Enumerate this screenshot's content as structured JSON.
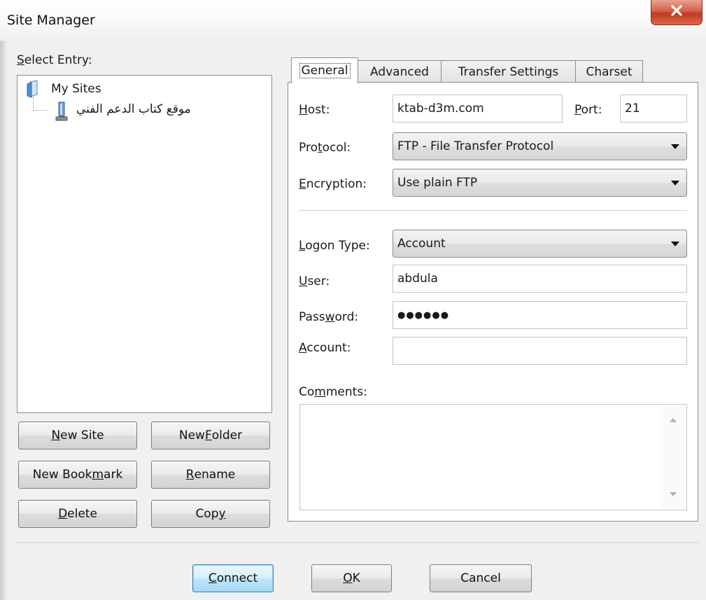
{
  "window": {
    "title": "Site Manager"
  },
  "select_entry": {
    "label_u": "S",
    "label_rest": "elect Entry:"
  },
  "tree": {
    "root": {
      "label": "My Sites",
      "icon": "folder-icon"
    },
    "site": {
      "label": "موقع كتاب الدعم الفني",
      "icon": "server-icon"
    }
  },
  "left_buttons": {
    "new_site": {
      "u": "N",
      "rest": "ew Site"
    },
    "new_folder": {
      "pre": "New ",
      "u": "F",
      "rest": "older"
    },
    "new_bookmark": {
      "pre": "New Book",
      "u": "m",
      "rest": "ark"
    },
    "rename": {
      "u": "R",
      "rest": "ename"
    },
    "delete": {
      "u": "D",
      "rest": "elete"
    },
    "copy": {
      "pre": "Cop",
      "u": "y"
    }
  },
  "tabs": [
    "General",
    "Advanced",
    "Transfer Settings",
    "Charset"
  ],
  "general": {
    "host": {
      "u": "H",
      "rest": "ost:",
      "value": "ktab-d3m.com"
    },
    "port": {
      "u": "P",
      "rest": "ort:",
      "value": "21"
    },
    "protocol": {
      "pre": "Pro",
      "u": "t",
      "rest": "ocol:",
      "value": "FTP - File Transfer Protocol"
    },
    "encryption": {
      "u": "E",
      "rest": "ncryption:",
      "value": "Use plain FTP"
    },
    "logon_type": {
      "u": "L",
      "rest": "ogon Type:",
      "value": "Account"
    },
    "user": {
      "u": "U",
      "rest": "ser:",
      "value": "abdula"
    },
    "password": {
      "pre": "Pass",
      "u": "w",
      "rest": "ord:",
      "value": "●●●●●●"
    },
    "account": {
      "u": "A",
      "rest": "ccount:",
      "value": ""
    },
    "comments": {
      "pre": "Co",
      "u": "m",
      "rest": "ments:",
      "value": ""
    }
  },
  "footer": {
    "connect": {
      "u": "C",
      "rest": "onnect"
    },
    "ok": {
      "u": "O",
      "rest": "K"
    },
    "cancel": {
      "label": "Cancel"
    }
  },
  "colors": {
    "close_button": "#c13a22",
    "default_button": "#3c7fb1",
    "panel_border": "#898c95"
  }
}
